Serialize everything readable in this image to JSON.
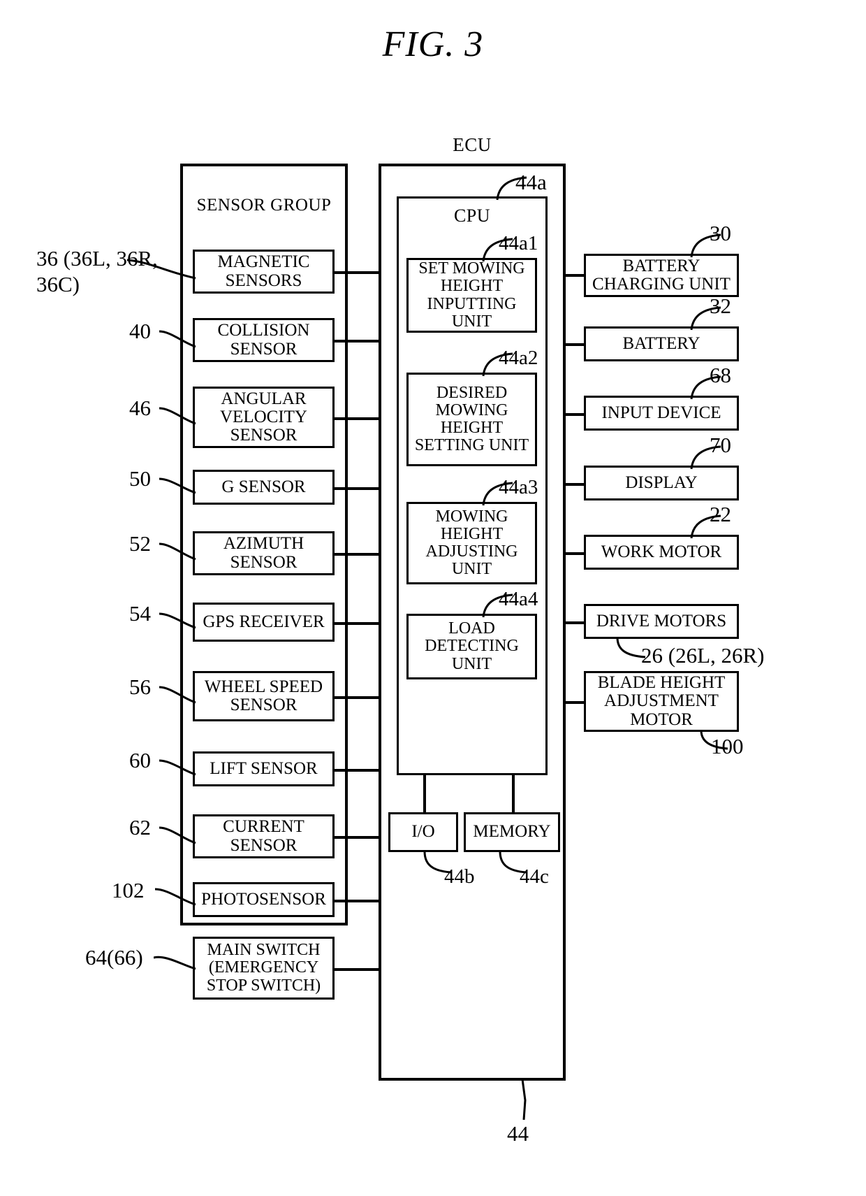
{
  "figure": {
    "title": "FIG. 3"
  },
  "sensor_group": {
    "heading": "SENSOR GROUP",
    "items": [
      {
        "label": "MAGNETIC SENSORS",
        "ref": "36 (36L, 36R,\n36C)"
      },
      {
        "label": "COLLISION SENSOR",
        "ref": "40"
      },
      {
        "label": "ANGULAR VELOCITY SENSOR",
        "ref": "46"
      },
      {
        "label": "G SENSOR",
        "ref": "50"
      },
      {
        "label": "AZIMUTH SENSOR",
        "ref": "52"
      },
      {
        "label": "GPS RECEIVER",
        "ref": "54"
      },
      {
        "label": "WHEEL SPEED SENSOR",
        "ref": "56"
      },
      {
        "label": "LIFT SENSOR",
        "ref": "60"
      },
      {
        "label": "CURRENT SENSOR",
        "ref": "62"
      },
      {
        "label": "PHOTOSENSOR",
        "ref": "102"
      }
    ]
  },
  "main_switch": {
    "label": "MAIN SWITCH (EMERGENCY STOP SWITCH)",
    "ref": "64(66)"
  },
  "ecu": {
    "heading": "ECU",
    "ref": "44",
    "cpu": {
      "heading": "CPU",
      "ref": "44a",
      "units": [
        {
          "label": "SET MOWING HEIGHT INPUTTING UNIT",
          "ref": "44a1"
        },
        {
          "label": "DESIRED MOWING HEIGHT SETTING UNIT",
          "ref": "44a2"
        },
        {
          "label": "MOWING HEIGHT ADJUSTING UNIT",
          "ref": "44a3"
        },
        {
          "label": "LOAD DETECTING UNIT",
          "ref": "44a4"
        }
      ]
    },
    "io": {
      "label": "I/O",
      "ref": "44b"
    },
    "memory": {
      "label": "MEMORY",
      "ref": "44c"
    }
  },
  "peripherals": {
    "items": [
      {
        "label": "BATTERY CHARGING UNIT",
        "ref": "30"
      },
      {
        "label": "BATTERY",
        "ref": "32"
      },
      {
        "label": "INPUT DEVICE",
        "ref": "68"
      },
      {
        "label": "DISPLAY",
        "ref": "70"
      },
      {
        "label": "WORK MOTOR",
        "ref": "22"
      },
      {
        "label": "DRIVE MOTORS",
        "ref": "26 (26L, 26R)"
      },
      {
        "label": "BLADE HEIGHT ADJUSTMENT MOTOR",
        "ref": "100"
      }
    ]
  },
  "colors": {
    "line": "#000000",
    "background": "#ffffff"
  }
}
